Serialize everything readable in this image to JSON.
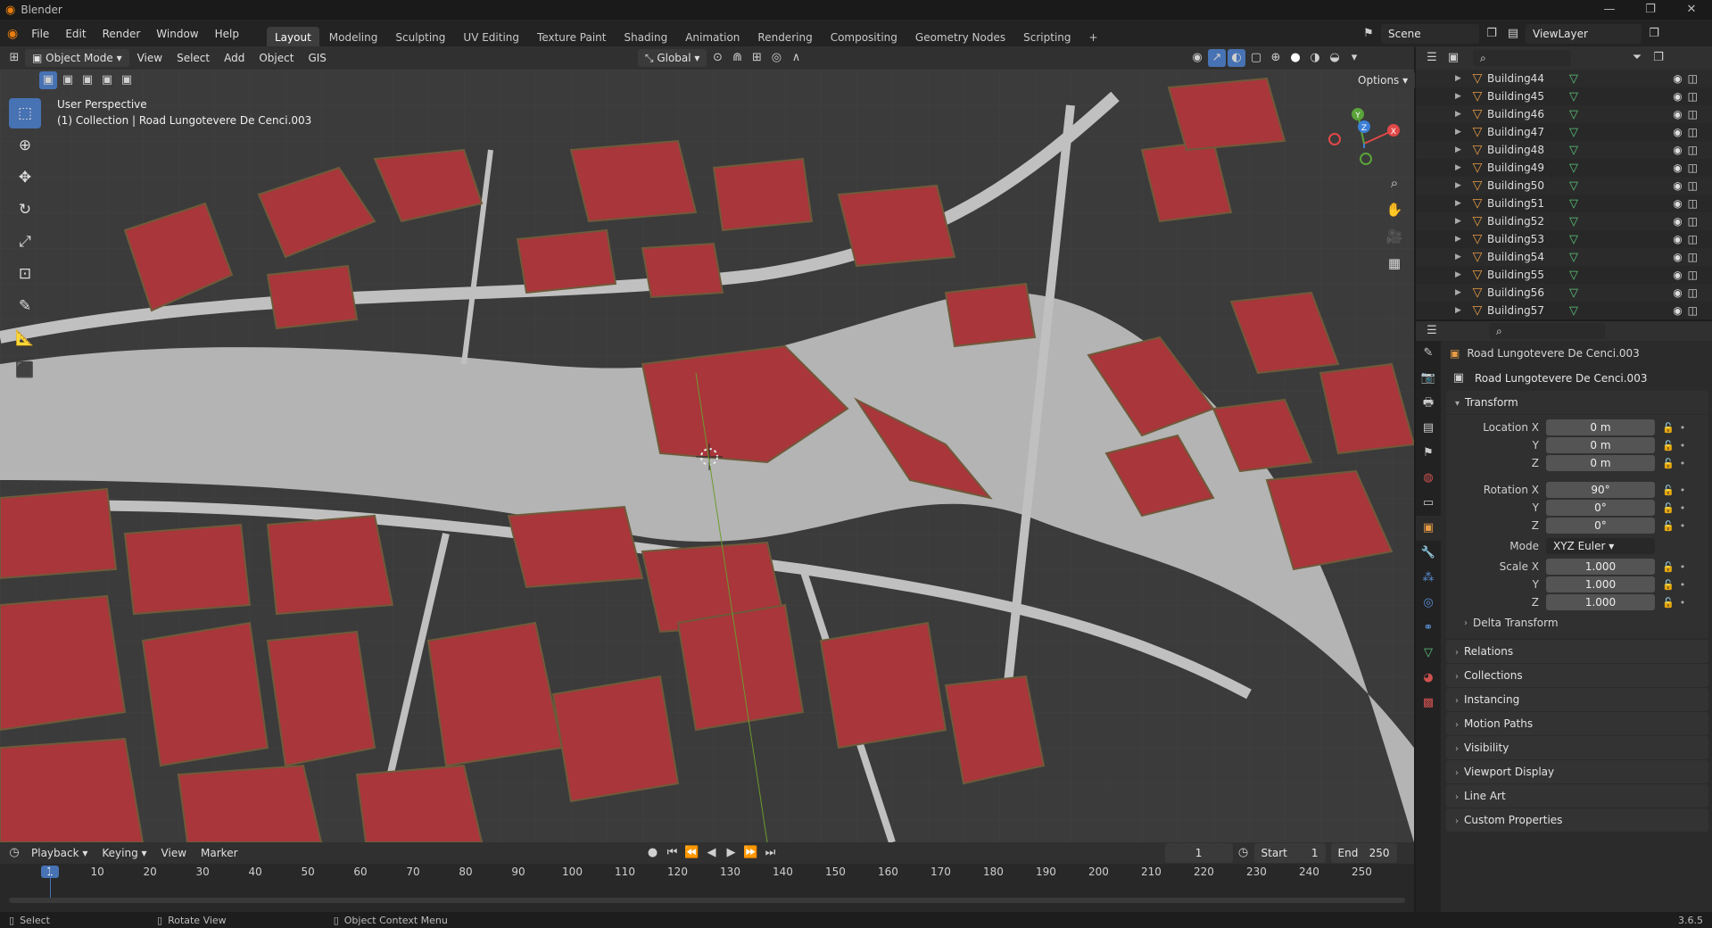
{
  "window": {
    "title": "Blender"
  },
  "menus": [
    "File",
    "Edit",
    "Render",
    "Window",
    "Help"
  ],
  "workspaces": [
    "Layout",
    "Modeling",
    "Sculpting",
    "UV Editing",
    "Texture Paint",
    "Shading",
    "Animation",
    "Rendering",
    "Compositing",
    "Geometry Nodes",
    "Scripting"
  ],
  "active_workspace": "Layout",
  "scene": "Scene",
  "view_layer": "ViewLayer",
  "viewport_header": {
    "mode": "Object Mode",
    "menus": [
      "View",
      "Select",
      "Add",
      "Object",
      "GIS"
    ],
    "orientation": "Global",
    "options": "Options"
  },
  "viewport_info": {
    "line1": "User Perspective",
    "line2": "(1) Collection | Road Lungotevere De Cenci.003"
  },
  "outliner_rows": [
    "Building44",
    "Building45",
    "Building46",
    "Building47",
    "Building48",
    "Building49",
    "Building50",
    "Building51",
    "Building52",
    "Building53",
    "Building54",
    "Building55",
    "Building56",
    "Building57"
  ],
  "properties": {
    "object_name": "Road Lungotevere De Cenci.003",
    "data_name": "Road Lungotevere De Cenci.003",
    "transform_label": "Transform",
    "location_label": "Location X",
    "rotation_label": "Rotation X",
    "scale_label": "Scale X",
    "y_label": "Y",
    "z_label": "Z",
    "location": [
      "0 m",
      "0 m",
      "0 m"
    ],
    "rotation": [
      "90°",
      "0°",
      "0°"
    ],
    "mode_label": "Mode",
    "mode": "XYZ Euler",
    "scale": [
      "1.000",
      "1.000",
      "1.000"
    ],
    "delta": "Delta Transform",
    "panels": [
      "Relations",
      "Collections",
      "Instancing",
      "Motion Paths",
      "Visibility",
      "Viewport Display",
      "Line Art",
      "Custom Properties"
    ]
  },
  "timeline": {
    "menus": [
      "Playback",
      "Keying",
      "View",
      "Marker"
    ],
    "current_frame": "1",
    "start_label": "Start",
    "start": "1",
    "end_label": "End",
    "end": "250",
    "ticks": [
      "1",
      "10",
      "20",
      "30",
      "40",
      "50",
      "60",
      "70",
      "80",
      "90",
      "100",
      "110",
      "120",
      "130",
      "140",
      "150",
      "160",
      "170",
      "180",
      "190",
      "200",
      "210",
      "220",
      "230",
      "240",
      "250"
    ]
  },
  "statusbar": {
    "select": "Select",
    "rotate": "Rotate View",
    "context": "Object Context Menu",
    "version": "3.6.5"
  },
  "colors": {
    "accent": "#4772b3",
    "building": "#a8363b",
    "road": "#b9b9b9",
    "ground": "#3b3b3b"
  }
}
